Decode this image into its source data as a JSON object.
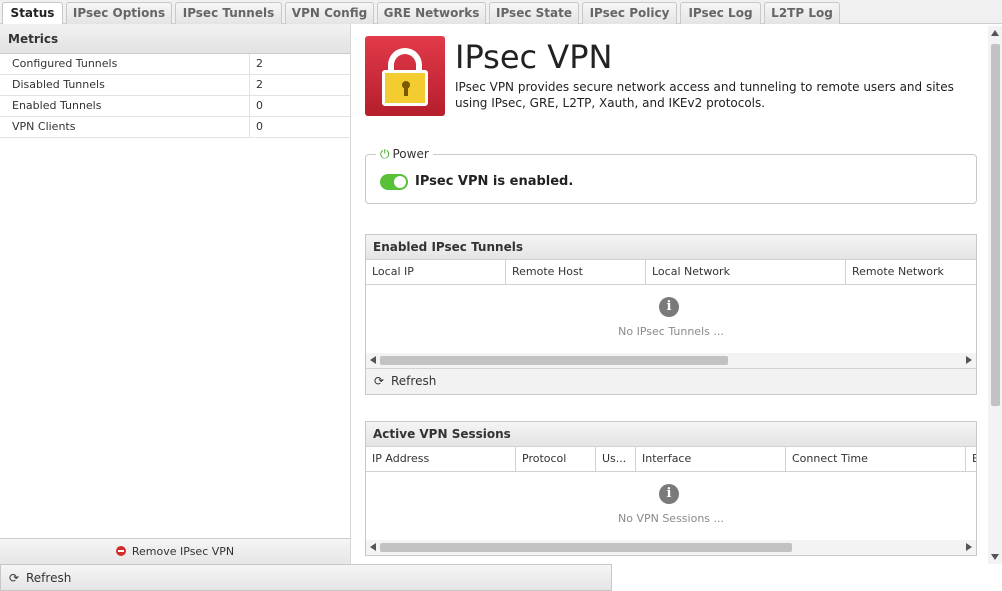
{
  "tabs": [
    {
      "label": "Status",
      "active": true
    },
    {
      "label": "IPsec Options",
      "active": false
    },
    {
      "label": "IPsec Tunnels",
      "active": false
    },
    {
      "label": "VPN Config",
      "active": false
    },
    {
      "label": "GRE Networks",
      "active": false
    },
    {
      "label": "IPsec State",
      "active": false
    },
    {
      "label": "IPsec Policy",
      "active": false
    },
    {
      "label": "IPsec Log",
      "active": false
    },
    {
      "label": "L2TP Log",
      "active": false
    }
  ],
  "metrics": {
    "title": "Metrics",
    "rows": [
      {
        "name": "Configured Tunnels",
        "value": "2"
      },
      {
        "name": "Disabled Tunnels",
        "value": "2"
      },
      {
        "name": "Enabled Tunnels",
        "value": "0"
      },
      {
        "name": "VPN Clients",
        "value": "0"
      }
    ],
    "remove_label": "Remove IPsec VPN"
  },
  "app": {
    "title": "IPsec VPN",
    "description": "IPsec VPN provides secure network access and tunneling to remote users and sites using IPsec, GRE, L2TP, Xauth, and IKEv2 protocols.",
    "icon": "padlock-icon",
    "accent_color": "#d42a3b"
  },
  "power": {
    "legend": "Power",
    "status_text": "IPsec VPN is enabled.",
    "enabled": true,
    "color": "#59c138"
  },
  "tunnels_grid": {
    "title": "Enabled IPsec Tunnels",
    "columns": [
      "Local IP",
      "Remote Host",
      "Local Network",
      "Remote Network"
    ],
    "empty_text": "No IPsec Tunnels ...",
    "refresh_label": "Refresh"
  },
  "sessions_grid": {
    "title": "Active VPN Sessions",
    "columns": [
      "IP Address",
      "Protocol",
      "Us...",
      "Interface",
      "Connect Time",
      "E"
    ],
    "empty_text": "No VPN Sessions ..."
  },
  "bottom": {
    "refresh_label": "Refresh"
  }
}
